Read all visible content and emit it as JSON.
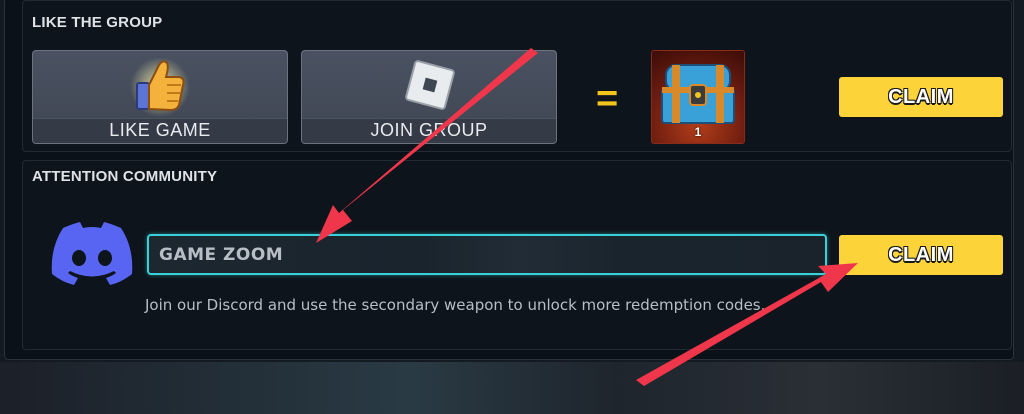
{
  "like_group": {
    "title": "LIKE THE GROUP",
    "like_game_label": "LIKE  GAME",
    "join_group_label": "JOIN GROUP",
    "equals_sign": "=",
    "reward_count": "1",
    "claim_label": "CLAIM"
  },
  "community": {
    "title": "ATTENTION COMMUNITY",
    "code_value": "GAME ZOOM",
    "claim_label": "CLAIM",
    "hint": "Join our Discord and use the secondary weapon to unlock more redemption codes."
  },
  "colors": {
    "accent_yellow": "#fcd43a",
    "input_border": "#3ad0d8",
    "discord_blue": "#5865f2",
    "arrow_red": "#f0364a"
  },
  "icons": [
    "thumbs-up-icon",
    "roblox-icon",
    "treasure-chest-icon",
    "discord-icon",
    "arrow-icon"
  ]
}
